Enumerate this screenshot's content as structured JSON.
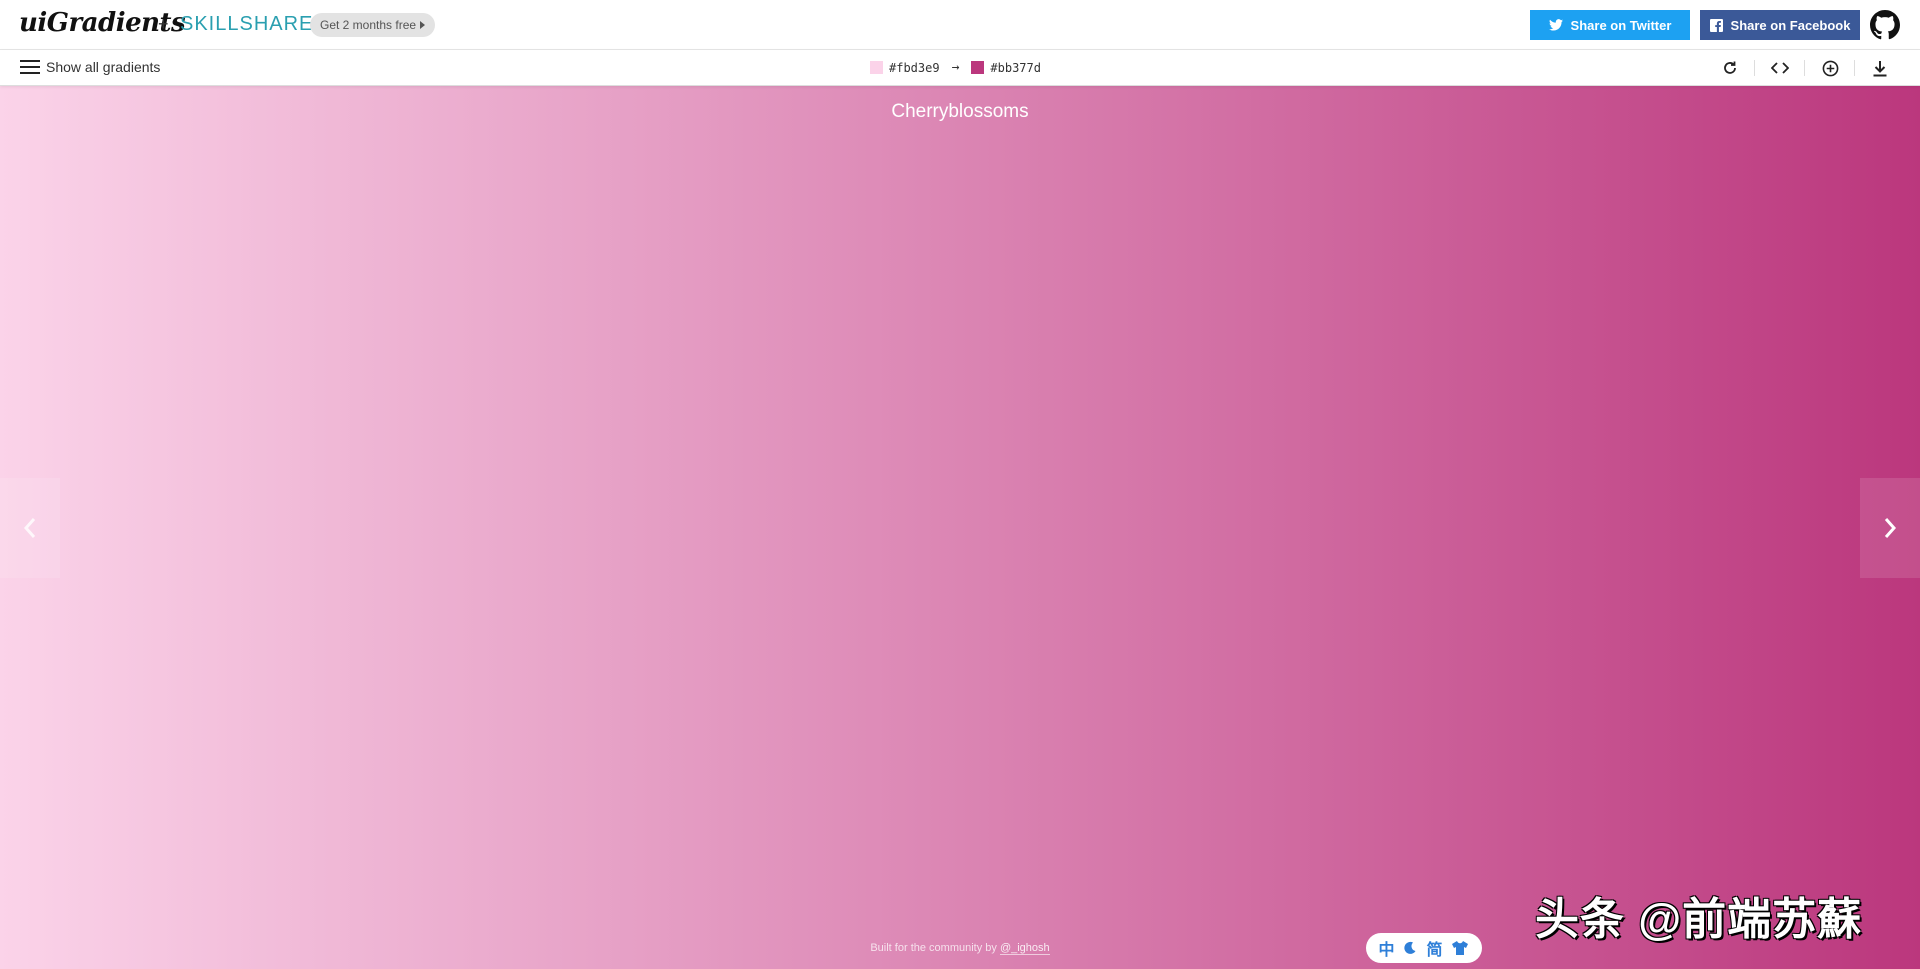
{
  "header": {
    "logo": "uiGradients",
    "plus": "+",
    "partner": "SKILLSHARE",
    "promo": "Get 2 months free",
    "share_twitter": "Share on Twitter",
    "share_facebook": "Share on Facebook",
    "icons": {
      "twitter": "twitter-icon",
      "facebook": "facebook-icon",
      "github": "github-icon"
    }
  },
  "toolbar": {
    "menu_label": "Show all gradients",
    "color_from": "#fbd3e9",
    "color_to": "#bb377d",
    "arrow": "→",
    "tools": [
      "rotate-icon",
      "code-icon",
      "add-icon",
      "download-icon"
    ]
  },
  "gradient": {
    "name": "Cherryblossoms",
    "from": "#fbd3e9",
    "to": "#bb377d"
  },
  "footer": {
    "text": "Built for the community by ",
    "author": "@_ighosh"
  },
  "ime_toolbar": {
    "items": [
      "中",
      "简"
    ],
    "icons": [
      "moon-icon",
      "shirt-icon"
    ]
  },
  "watermark": "头条 @前端苏蘇",
  "colors": {
    "twitter": "#1da1f2",
    "facebook": "#3b5998",
    "skillshare": "#2a9fb0"
  }
}
